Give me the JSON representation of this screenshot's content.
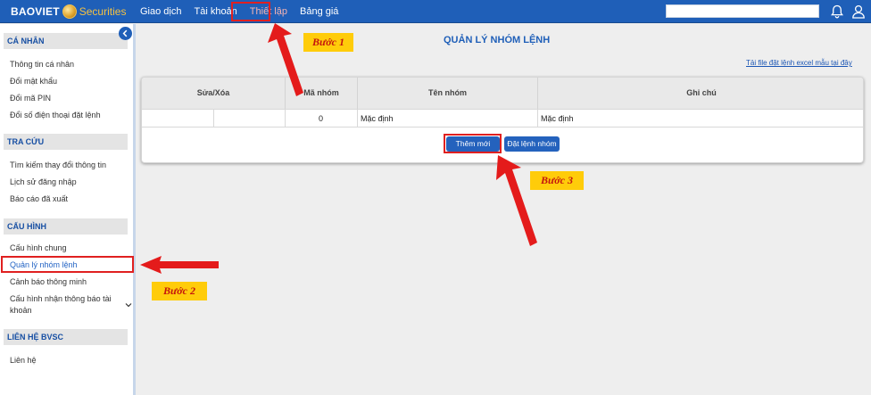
{
  "header": {
    "logo_left": "BAOVIET",
    "logo_right": "Securities",
    "nav": [
      "Giao dịch",
      "Tài khoản",
      "Thiết lập",
      "Bảng giá"
    ],
    "search_value": "",
    "icons": [
      "bell-icon",
      "user-icon"
    ],
    "colors": {
      "bar": "#1f5fb8",
      "active_text": "#f3b3b3"
    }
  },
  "sidebar": {
    "sections": [
      {
        "title": "CÁ NHÂN",
        "items": [
          "Thông tin cá nhân",
          "Đổi mật khẩu",
          "Đổi mã PIN",
          "Đổi số điện thoại đặt lệnh"
        ]
      },
      {
        "title": "TRA CỨU",
        "items": [
          "Tìm kiếm thay đổi thông tin",
          "Lịch sử đăng nhập",
          "Báo cáo đã xuất"
        ]
      },
      {
        "title": "CẤU HÌNH",
        "items": [
          "Cấu hình chung",
          "Quản lý nhóm lệnh",
          "Cảnh báo thông minh",
          "Cấu hình nhận thông báo tài khoản"
        ]
      },
      {
        "title": "LIÊN HỆ BVSC",
        "items": [
          "Liên hệ"
        ]
      }
    ],
    "active_item": "Quản lý nhóm lệnh"
  },
  "main": {
    "title": "QUẢN LÝ NHÓM LỆNH",
    "excel_link": "Tải file đặt lệnh excel mẫu tại đây",
    "table": {
      "columns": [
        "Sửa/Xóa",
        "Mã nhóm",
        "Tên nhóm",
        "Ghi chú"
      ],
      "rows": [
        {
          "edit": "",
          "delete": "",
          "ma_nhom": "0",
          "ten_nhom": "Mặc định",
          "ghi_chu": "Mặc định"
        }
      ]
    },
    "buttons": {
      "add": "Thêm mới",
      "group_order": "Đặt lệnh nhóm"
    }
  },
  "annotations": {
    "step1": "Bước 1",
    "step2": "Bước 2",
    "step3": "Bước 3",
    "highlight_color": "#e02020",
    "label_bg": "#ffcc0a"
  }
}
